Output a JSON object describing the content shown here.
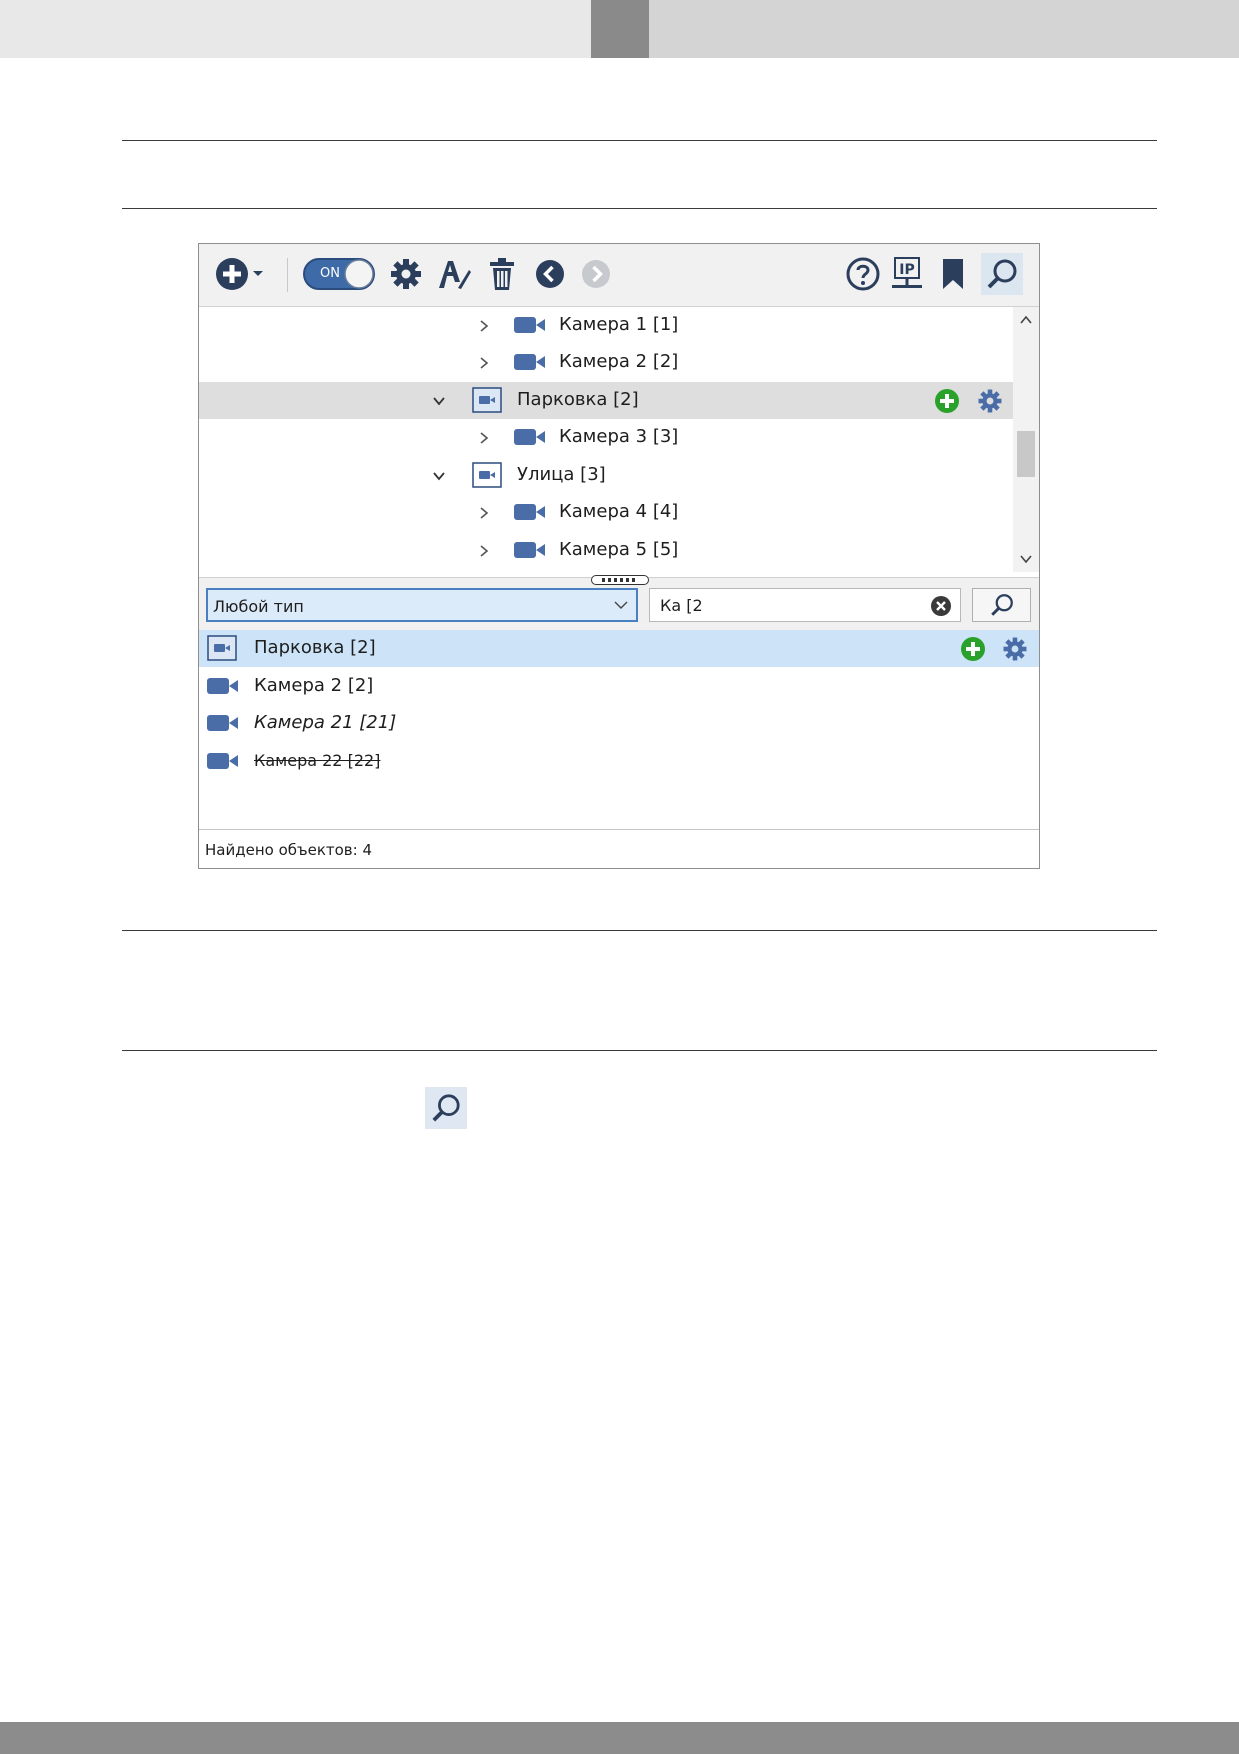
{
  "colors": {
    "accent": "#4a6da7",
    "toggle_on": "#3f6aa8",
    "add_green": "#2aa12a",
    "selected_row": "#dedede",
    "highlighted_result": "#cde4f8"
  },
  "toolbar": {
    "items": [
      {
        "icon": "add-circle-icon"
      },
      {
        "icon": "dropdown-arrow-icon"
      },
      {
        "icon": "toggle-on-icon",
        "label": "ON"
      },
      {
        "icon": "gear-icon"
      },
      {
        "icon": "rename-icon"
      },
      {
        "icon": "trash-icon"
      },
      {
        "icon": "back-icon"
      },
      {
        "icon": "forward-icon"
      },
      {
        "icon": "help-icon"
      },
      {
        "icon": "ip-network-icon",
        "label": "IP"
      },
      {
        "icon": "bookmark-icon"
      },
      {
        "icon": "search-icon"
      }
    ]
  },
  "tree": {
    "items": [
      {
        "label": "Камера 1 [1]",
        "type": "camera",
        "expanded": false
      },
      {
        "label": "Камера 2 [2]",
        "type": "camera",
        "expanded": false
      },
      {
        "label": "Парковка [2]",
        "type": "group",
        "expanded": true,
        "selected": true
      },
      {
        "label": "Камера 3 [3]",
        "type": "camera",
        "expanded": false
      },
      {
        "label": "Улица [3]",
        "type": "group",
        "expanded": true
      },
      {
        "label": "Камера 4 [4]",
        "type": "camera",
        "expanded": false
      },
      {
        "label": "Камера 5 [5]",
        "type": "camera",
        "expanded": false
      }
    ]
  },
  "filter": {
    "type_value": "Любой тип",
    "search_value": "Ка [2"
  },
  "results": {
    "items": [
      {
        "label": "Парковка [2]",
        "style": "normal",
        "highlighted": true
      },
      {
        "label": "Камера 2 [2]",
        "style": "normal"
      },
      {
        "label": "Камера 21 [21]",
        "style": "italic"
      },
      {
        "label": "Камера 22 [22]",
        "style": "strikethrough"
      }
    ],
    "status": "Найдено объектов: 4"
  }
}
